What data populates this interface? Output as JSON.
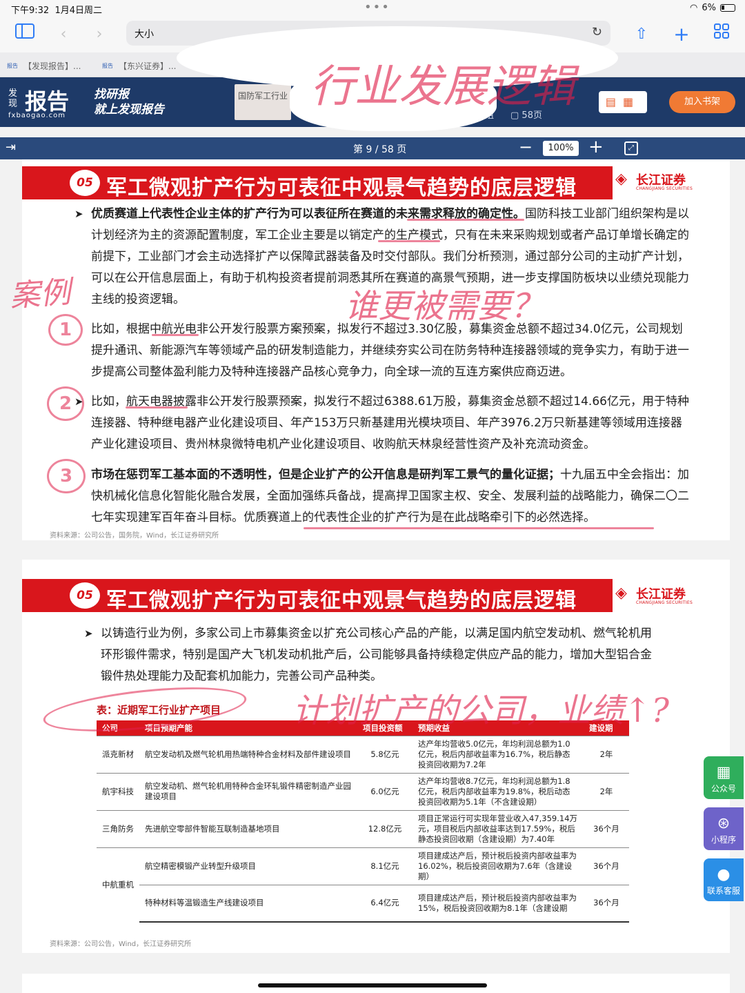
{
  "status": {
    "time": "下午9:32",
    "date": "1月4日周二",
    "battery": "6%"
  },
  "browser": {
    "address_text": "大小"
  },
  "tabs": [
    {
      "icon": "报告",
      "label": "【发现报告】..."
    },
    {
      "icon": "报告",
      "label": "【东兴证券】..."
    }
  ],
  "site": {
    "logo_small": "发现",
    "logo_big": "报告",
    "logo_url": "fxbaogao.com",
    "slogan_1": "找研报",
    "slogan_2": "就上发现报告",
    "industry": "国防军工行业",
    "meta_author": "小姐",
    "meta_pages": "58页",
    "bookshelf": "加入书架"
  },
  "viewer": {
    "page_label": "第 9 / 58 页",
    "zoom": "100%"
  },
  "slide1": {
    "badge": "05",
    "title": "军工微观扩产行为可表征中观景气趋势的底层逻辑",
    "brand_cn": "长江证券",
    "brand_en": "CHANGJIANG SECURITIES",
    "p1_bold": "优质赛道上代表性企业主体的扩产行为可以表征所在赛道的未来需求释放的确定性。",
    "p1_rest": "国防科技工业部门组织架构是以计划经济为主的资源配置制度，军工企业主要是以销定产的生产模式，只有在未来采购规划或者产品订单增长确定的前提下，工业部门才会主动选择扩产以保障武器装备及时交付部队。我们分析预测，通过部分公司的主动扩产计划，可以在公开信息层面上，有助于机构投资者提前洞悉其所在赛道的高景气预期，进一步支撑国防板块以业绩兑现能力主线的投资逻辑。",
    "p2": "比如，根据中航光电非公开发行股票方案预案，拟发行不超过3.30亿股，募集资金总额不超过34.0亿元，公司规划提升通讯、新能源汽车等领域产品的研发制造能力，并继续夯实公司在防务特种连接器领域的竞争实力，有助于进一步提高公司整体盈利能力及特种连接器产品核心竞争力，向全球一流的互连方案供应商迈进。",
    "p3": "比如，航天电器披露非公开发行股票预案，拟发行不超过6388.61万股，募集资金总额不超过14.66亿元，用于特种连接器、特种继电器产业化建设项目、年产153万只新基建用光模块项目、年产3976.2万只新基建等领域用连接器产业化建设项目、贵州林泉微特电机产业化建设项目、收购航天林泉经营性资产及补充流动资金。",
    "p4_bold": "市场在惩罚军工基本面的不透明性，但是企业扩产的公开信息是研判军工景气的量化证据；",
    "p4_rest": "十九届五中全会指出：加快机械化信息化智能化融合发展，全面加强练兵备战，提高捍卫国家主权、安全、发展利益的战略能力，确保二〇二七年实现建军百年奋斗目标。优质赛道上的代表性企业的扩产行为是在此战略牵引下的必然选择。",
    "source": "资料来源：公司公告，国务院，Wind，长江证券研究所"
  },
  "slide2": {
    "badge": "05",
    "title": "军工微观扩产行为可表征中观景气趋势的底层逻辑",
    "brand_cn": "长江证券",
    "brand_en": "CHANGJIANG SECURITIES",
    "p1": "以铸造行业为例，多家公司上市募集资金以扩充公司核心产品的产能，以满足国内航空发动机、燃气轮机用环形锻件需求，特别是国产大飞机发动机批产后，公司能够具备持续稳定供应产品的能力，增加大型铝合金锻件热处理能力及配套机加能力，完善公司产品种类。",
    "table_caption": "表：近期军工行业扩产项目",
    "table_headers": [
      "公司",
      "项目预期产能",
      "项目投资额",
      "预期收益",
      "建设期"
    ],
    "table_rows": [
      {
        "company": "派克新材",
        "project": "航空发动机及燃气轮机用热端特种合金材料及部件建设项目",
        "invest": "5.8亿元",
        "return": "达产年均营收5.0亿元，年均利润总额为1.0亿元，税后内部收益率为16.7%，税后静态投资回收期为7.2年",
        "period": "2年"
      },
      {
        "company": "航宇科技",
        "project": "航空发动机、燃气轮机用特种合金环轧锻件精密制造产业园建设项目",
        "invest": "6.0亿元",
        "return": "达产年均营收8.7亿元，年均利润总额为1.8亿元，税后内部收益率为19.8%，税后动态投资回收期为5.1年（不含建设期）",
        "period": "2年"
      },
      {
        "company": "三角防务",
        "project": "先进航空零部件智能互联制造基地项目",
        "invest": "12.8亿元",
        "return": "项目正常运行可实现年营业收入47,359.14万元，项目税后内部收益率达到17.59%，税后静态投资回收期（含建设期）为7.40年",
        "period": "36个月"
      },
      {
        "company": "中航重机",
        "project": "航空精密模锻产业转型升级项目",
        "invest": "8.1亿元",
        "return": "项目建成达产后，预计税后投资内部收益率为16.02%，税后投资回收期为7.6年（含建设期）",
        "period": "36个月"
      },
      {
        "company": "",
        "project": "特种材料等温锻造生产线建设项目",
        "invest": "6.4亿元",
        "return": "项目建成达产后，预计税后投资内部收益率为15%，税后投资回收期为8.1年（含建设期",
        "period": "36个月"
      }
    ],
    "source": "资料来源：公司公告，Wind，长江证券研究所"
  },
  "annotations": {
    "top": "行业发展逻辑",
    "case": "案例",
    "who_needs": "谁更被需要？",
    "n1": "1",
    "n2": "2",
    "n3": "3",
    "plan": "计划扩产的公司，业绩↑?"
  },
  "floating": [
    {
      "icon": "qr-icon",
      "label": "公众号",
      "color": "#2fae5c"
    },
    {
      "icon": "miniprogram-icon",
      "label": "小程序",
      "color": "#6e63c9"
    },
    {
      "icon": "chat-icon",
      "label": "联系客服",
      "color": "#2b8fe6"
    }
  ]
}
